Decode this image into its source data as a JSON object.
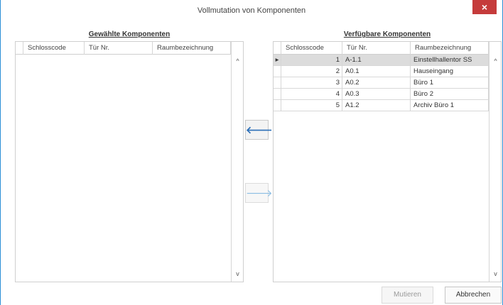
{
  "window": {
    "title": "Vollmutation von Komponenten",
    "close_glyph": "×"
  },
  "left_panel": {
    "title": "Gewählte Komponenten",
    "columns": [
      "Schlosscode",
      "Tür Nr.",
      "Raumbezeichnung"
    ]
  },
  "right_panel": {
    "title": "Verfügbare Komponenten",
    "columns": [
      "Schlosscode",
      "Tür Nr.",
      "Raumbezeichnung"
    ],
    "rows": [
      {
        "indicator": "▸",
        "code": "1",
        "door": "A-1.1",
        "room": "Einstellhallentor SS",
        "selected": true
      },
      {
        "indicator": "",
        "code": "2",
        "door": "A0.1",
        "room": "Hauseingang",
        "selected": false
      },
      {
        "indicator": "",
        "code": "3",
        "door": "A0.2",
        "room": "Büro 1",
        "selected": false
      },
      {
        "indicator": "",
        "code": "4",
        "door": "A0.3",
        "room": "Büro 2",
        "selected": false
      },
      {
        "indicator": "",
        "code": "5",
        "door": "A1.2",
        "room": "Archiv Büro 1",
        "selected": false
      }
    ]
  },
  "transfer": {
    "to_left_glyph": "🡐",
    "to_right_glyph": "🡒"
  },
  "scroll": {
    "up_glyph": "^",
    "down_glyph": "v"
  },
  "buttons": {
    "mutieren": "Mutieren",
    "abbrechen": "Abbrechen"
  }
}
